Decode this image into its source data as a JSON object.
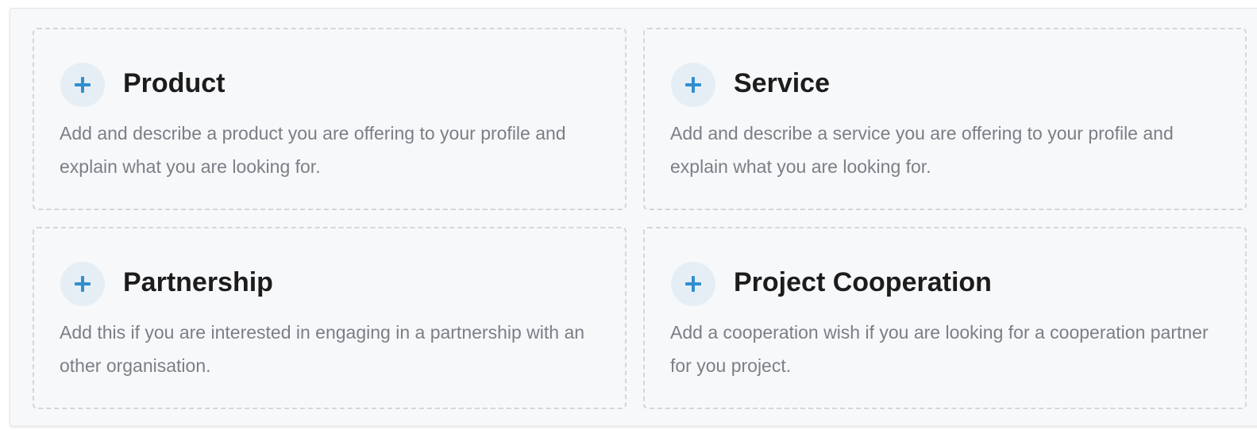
{
  "colors": {
    "accent": "#2f8fcf",
    "icon_bg": "#e6eef5",
    "title": "#1c1c1c",
    "description": "#7a7f86",
    "dashed_border": "#d3d7dc",
    "panel_bg": "#f7f8fa"
  },
  "cards": [
    {
      "icon": "plus-icon",
      "title": "Product",
      "description": "Add and describe a product you are offering to your profile and explain what you are looking for."
    },
    {
      "icon": "plus-icon",
      "title": "Service",
      "description": "Add and describe a service you are offering to your profile and explain what you are looking for."
    },
    {
      "icon": "plus-icon",
      "title": "Partnership",
      "description": "Add this if you are interested in engaging in a partnership with an other organisation."
    },
    {
      "icon": "plus-icon",
      "title": "Project Cooperation",
      "description": "Add a cooperation wish if you are looking for a cooperation partner for you project."
    }
  ]
}
